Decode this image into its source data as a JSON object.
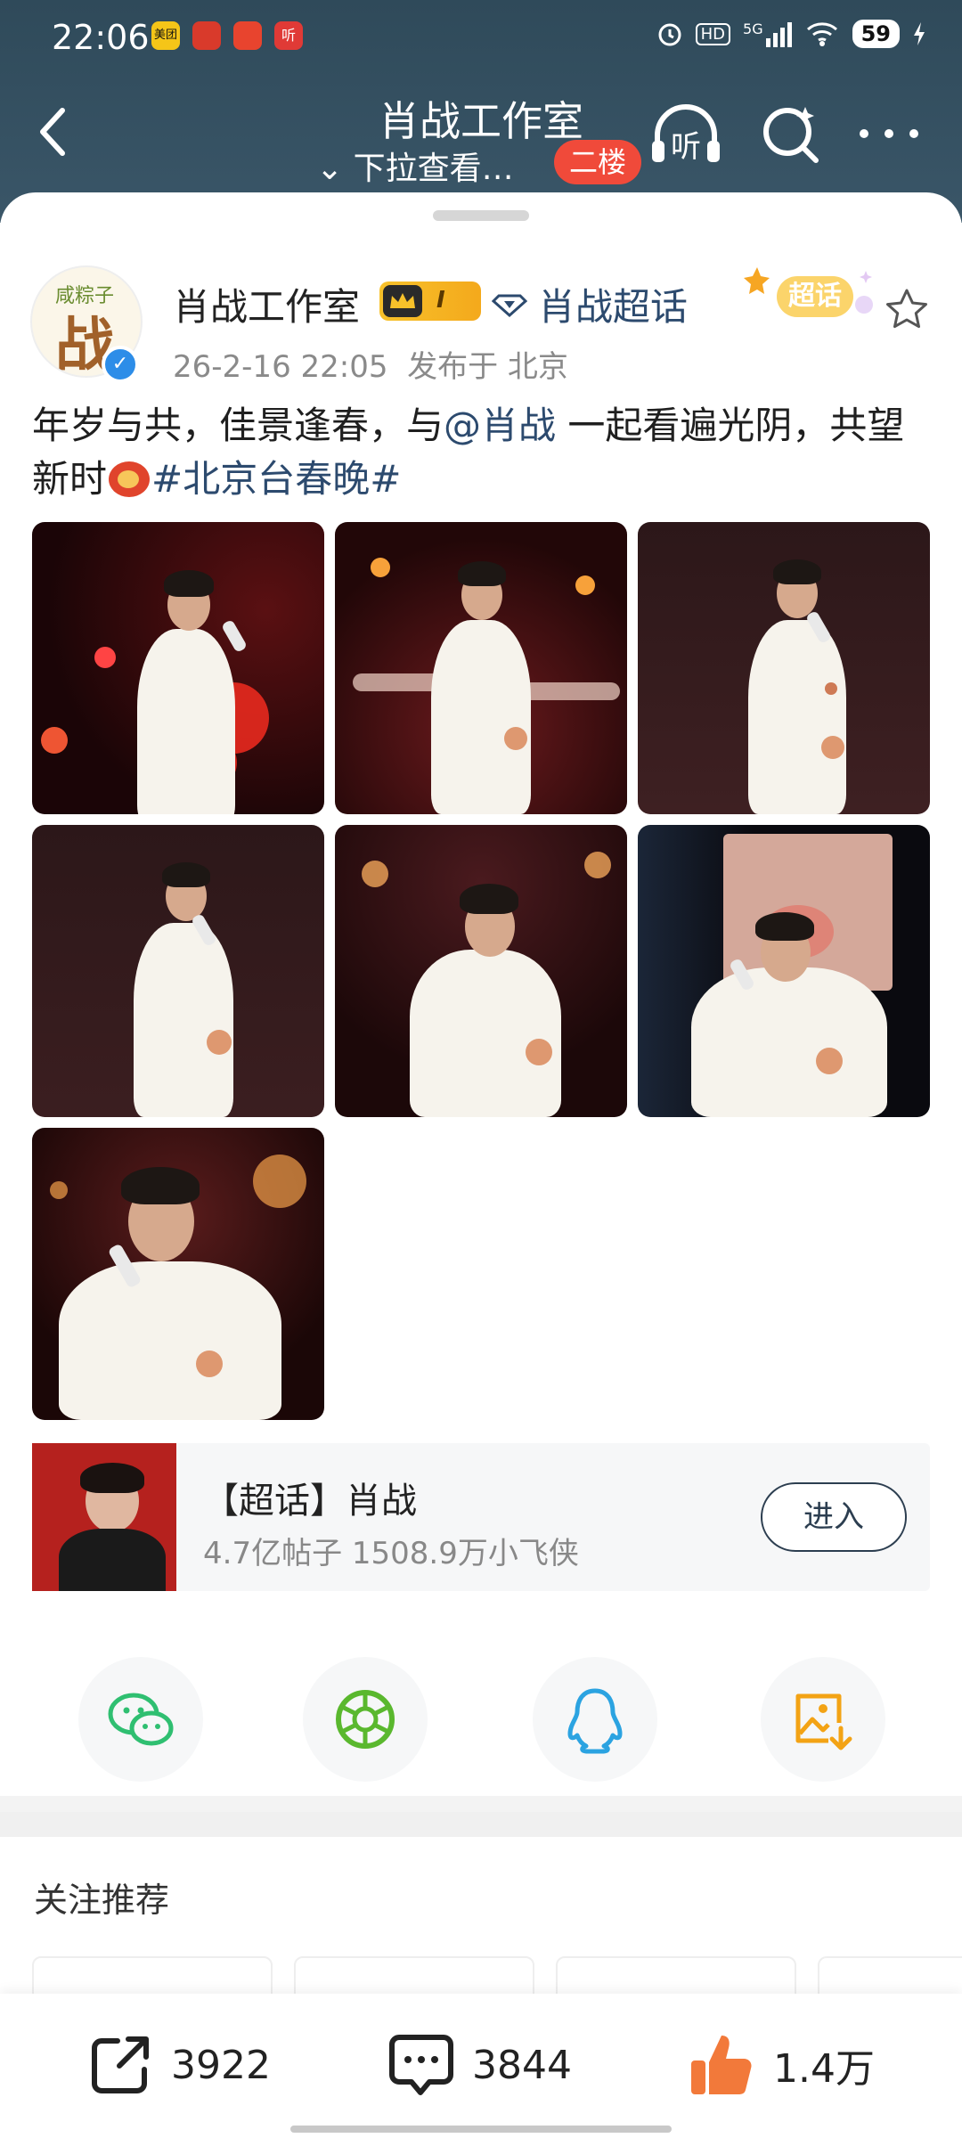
{
  "status_bar": {
    "time": "22:06",
    "notif_apps": [
      "美团",
      "",
      "",
      "听"
    ],
    "network": "5G",
    "hd": "HD",
    "battery": "59"
  },
  "nav": {
    "title": "肖战工作室",
    "subtitle": "⌄ 下拉查看…",
    "floor_badge": "二楼",
    "listen_label": "听"
  },
  "post": {
    "author": "肖战工作室",
    "rank_level": "I",
    "supertopic_link": "肖战超话",
    "supertopic_badge": "超话",
    "date": "26-2-16 22:05",
    "location": "发布于 北京",
    "avatar_caption": "咸粽子",
    "avatar_char": "战",
    "text_part1": "年岁与共，佳景逢春，与",
    "mention": "@肖战",
    "text_part2": " 一起看遍光阴，共望新时",
    "hashtag": "#北京台春晚#",
    "image_count": 7
  },
  "supertopic_card": {
    "title": "【超话】肖战",
    "stats": "4.7亿帖子 1508.9万小飞侠",
    "enter_label": "进入"
  },
  "share": [
    "wechat-icon",
    "moments-icon",
    "qq-icon",
    "save-image-icon"
  ],
  "recommend": {
    "title": "关注推荐"
  },
  "actions": {
    "repost_count": "3922",
    "comment_count": "3844",
    "like_count": "1.4万"
  },
  "colors": {
    "header": "#33505f",
    "link": "#2c4a6e",
    "badge_red": "#f04a3a",
    "like_orange": "#f2793a"
  }
}
